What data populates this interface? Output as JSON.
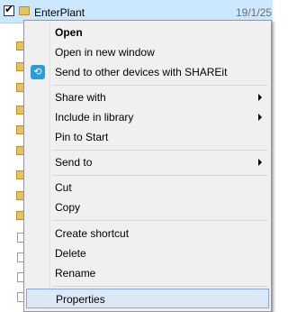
{
  "explorer": {
    "selected_row": {
      "name": "EnterPlant",
      "date": "19/1/25",
      "checked": true
    }
  },
  "context_menu": {
    "items": [
      {
        "label": "Open",
        "bold": true
      },
      {
        "label": "Open in new window"
      },
      {
        "label": "Send to other devices with SHAREit",
        "icon": "shareit-icon"
      },
      {
        "label": "Share with",
        "submenu": true
      },
      {
        "label": "Include in library",
        "submenu": true
      },
      {
        "label": "Pin to Start"
      },
      {
        "label": "Send to",
        "submenu": true
      },
      {
        "label": "Cut"
      },
      {
        "label": "Copy"
      },
      {
        "label": "Create shortcut"
      },
      {
        "label": "Delete"
      },
      {
        "label": "Rename"
      },
      {
        "label": "Properties",
        "highlighted": true
      }
    ]
  },
  "colors": {
    "selection_row": "#cce8ff",
    "menu_background": "#f0f0f0",
    "menu_highlight": "#dde8f7",
    "shareit_icon": "#2d9cdb"
  }
}
